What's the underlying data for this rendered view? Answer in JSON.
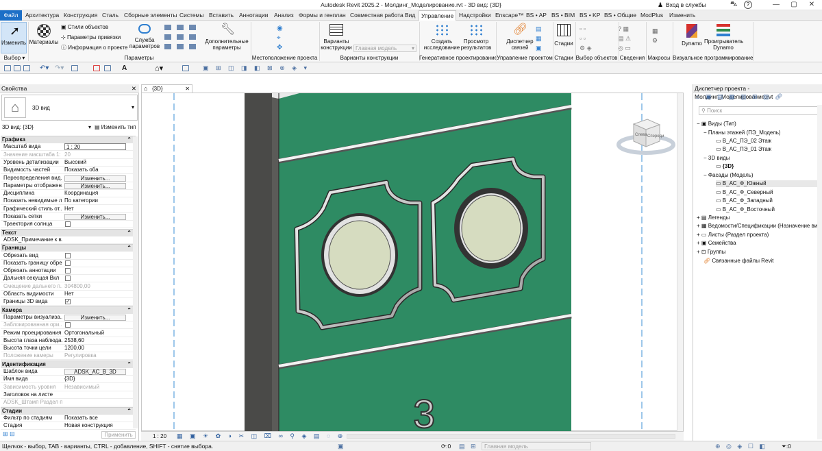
{
  "app": {
    "title": "Autodesk Revit 2025.2 - Молдинг_Моделирование.rvt - 3D вид: {3D}",
    "account": "Вход в службы",
    "help": "?"
  },
  "tabs": [
    "Файл",
    "Архитектура",
    "Конструкция",
    "Сталь",
    "Сборные элементы",
    "Системы",
    "Вставить",
    "Аннотации",
    "Анализ",
    "Формы и генплан",
    "Совместная работа",
    "Вид",
    "Управление",
    "Надстройки",
    "Enscape™",
    "BS • AP",
    "BS • BIM",
    "BS • KP",
    "BS • Общие",
    "ModPlus",
    "Изменить"
  ],
  "ribbon": {
    "modify": "Изменить",
    "materials": "Материалы",
    "object_styles": "Стили объектов",
    "snaps": "Параметры привязки",
    "project_info": "Информация о проекте",
    "project_params": "Служба параметров",
    "extra": "Дополнительные параметры",
    "variants": "Варианты конструкции",
    "main_model": "Главная модель",
    "create": "Создать исследование",
    "view_results": "Просмотр результатов",
    "links": "Диспетчер связей",
    "phases": "Стадии",
    "dynamo": "Dynamo",
    "dynamo_player": "Проигрыватель Dynamo",
    "panels": [
      "Выбор",
      "Параметры",
      "Местоположение проекта",
      "Варианты конструкции",
      "Генеративное проектирование",
      "Управление проектом",
      "Стадии",
      "Выбор объектов",
      "Сведения",
      "Макросы",
      "Визуальное программирование"
    ]
  },
  "properties": {
    "title": "Свойства",
    "type": "3D вид",
    "selector": "3D вид: {3D}",
    "edit_type": "Изменить тип",
    "sections": [
      {
        "name": "Графика",
        "rows": [
          {
            "k": "Масштаб вида",
            "v": "1 : 20",
            "input": true
          },
          {
            "k": "Значение масштаба",
            "v": "20",
            "dis": true,
            "pre": "1:"
          },
          {
            "k": "Уровень детализации",
            "v": "Высокий"
          },
          {
            "k": "Видимость частей",
            "v": "Показать оба"
          },
          {
            "k": "Переопределения вид...",
            "v": "Изменить...",
            "btn": true
          },
          {
            "k": "Параметры отображен...",
            "v": "Изменить...",
            "btn": true
          },
          {
            "k": "Дисциплина",
            "v": "Координация"
          },
          {
            "k": "Показать невидимые л...",
            "v": "По категории"
          },
          {
            "k": "Графический стиль от...",
            "v": "Нет"
          },
          {
            "k": "Показать сетки",
            "v": "Изменить...",
            "btn": true
          },
          {
            "k": "Траектория солнца",
            "v": "",
            "chk": false
          }
        ]
      },
      {
        "name": "Текст",
        "rows": [
          {
            "k": "ADSK_Примечание к в...",
            "v": ""
          }
        ]
      },
      {
        "name": "Границы",
        "rows": [
          {
            "k": "Обрезать вид",
            "v": "",
            "chk": false
          },
          {
            "k": "Показать границу обре...",
            "v": "",
            "chk": false
          },
          {
            "k": "Обрезать аннотации",
            "v": "",
            "chk": false
          },
          {
            "k": "Дальняя секущая Вкл",
            "v": "",
            "chk": false
          },
          {
            "k": "Смещение дальнего п...",
            "v": "304800,00",
            "dis": true
          },
          {
            "k": "Область видимости",
            "v": "Нет"
          },
          {
            "k": "Границы 3D вида",
            "v": "",
            "chk": true
          }
        ]
      },
      {
        "name": "Камера",
        "rows": [
          {
            "k": "Параметры визуализа...",
            "v": "Изменить...",
            "btn": true
          },
          {
            "k": "Заблокированная ори...",
            "v": "",
            "chk": false,
            "dis": true
          },
          {
            "k": "Режим проецирования",
            "v": "Ортогональный"
          },
          {
            "k": "Высота глаза наблюда...",
            "v": "2538,60"
          },
          {
            "k": "Высота точки цели",
            "v": "1200,00"
          },
          {
            "k": "Положение камеры",
            "v": "Регулировка",
            "dis": true
          }
        ]
      },
      {
        "name": "Идентификация",
        "rows": [
          {
            "k": "Шаблон вида",
            "v": "ADSK_АС_В_3D",
            "btn": true
          },
          {
            "k": "Имя вида",
            "v": "{3D}"
          },
          {
            "k": "Зависимость уровня",
            "v": "Независимый",
            "dis": true
          },
          {
            "k": "Заголовок на листе",
            "v": ""
          },
          {
            "k": "ADSK_Штамп Раздел п...",
            "v": "",
            "dis": true
          }
        ]
      },
      {
        "name": "Стадии",
        "rows": [
          {
            "k": "Фильтр по стадиям",
            "v": "Показать все"
          },
          {
            "k": "Стадия",
            "v": "Новая конструкция"
          }
        ]
      }
    ],
    "apply": "Применить"
  },
  "view": {
    "tab": "{3D}",
    "number": "3",
    "scale": "1 : 20",
    "cube_front": "Спереди",
    "cube_left": "Слева"
  },
  "browser": {
    "title": "Диспетчер проекта - Молдинг_Моделирование.rvt",
    "search": "Поиск",
    "views": "Виды (Тип)",
    "floor_plans": "Планы этажей (ПЭ_Модель)",
    "plan1": "В_АС_ПЭ_02 Этаж",
    "plan2": "В_АС_ПЭ_01 Этаж",
    "views3d": "3D виды",
    "v3d": "{3D}",
    "facades": "Фасады (Модель)",
    "f1": "В_АС_Ф_Южный",
    "f2": "В_АС_Ф_Северный",
    "f3": "В_АС_Ф_Западный",
    "f4": "В_АС_Ф_Восточный",
    "legends": "Легенды",
    "schedules": "Ведомости/Спецификации (Назначение вида)",
    "sheets": "Листы (Раздел проекта)",
    "families": "Семейства",
    "groups": "Группы",
    "links": "Связанные файлы Revit"
  },
  "status": {
    "hint": "Щелчок - выбор, TAB - варианты, CTRL - добавление, SHIFT - снятие выбора.",
    "zero1": ":0",
    "zero2": ":0",
    "model": "Главная модель",
    "filter": ":0"
  },
  "colors": {
    "accent": "#1c6fc7",
    "wall": "#2e8b63",
    "column": "#4a4a48",
    "glass": "#d6dcc0"
  }
}
